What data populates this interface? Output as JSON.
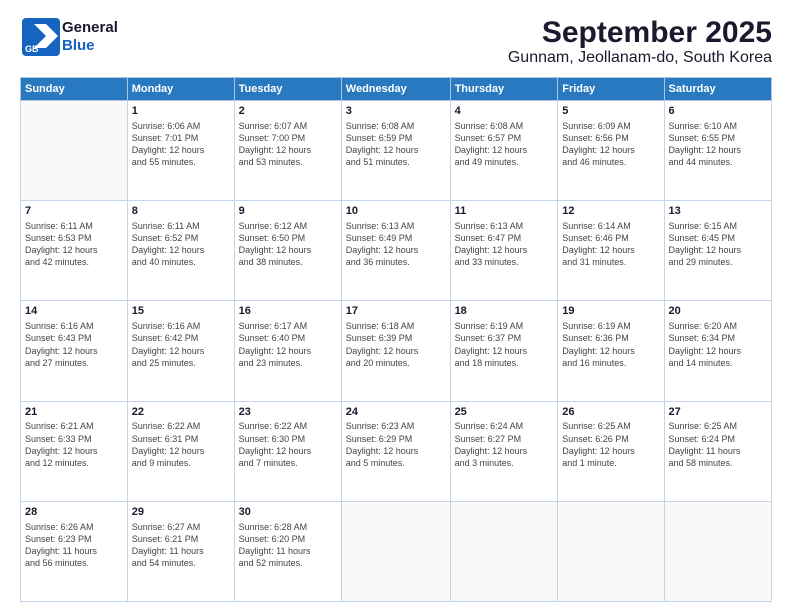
{
  "header": {
    "logo_line1": "General",
    "logo_line2": "Blue",
    "title": "September 2025",
    "subtitle": "Gunnam, Jeollanam-do, South Korea"
  },
  "calendar": {
    "days_of_week": [
      "Sunday",
      "Monday",
      "Tuesday",
      "Wednesday",
      "Thursday",
      "Friday",
      "Saturday"
    ],
    "weeks": [
      [
        {
          "day": "",
          "info": ""
        },
        {
          "day": "1",
          "info": "Sunrise: 6:06 AM\nSunset: 7:01 PM\nDaylight: 12 hours\nand 55 minutes."
        },
        {
          "day": "2",
          "info": "Sunrise: 6:07 AM\nSunset: 7:00 PM\nDaylight: 12 hours\nand 53 minutes."
        },
        {
          "day": "3",
          "info": "Sunrise: 6:08 AM\nSunset: 6:59 PM\nDaylight: 12 hours\nand 51 minutes."
        },
        {
          "day": "4",
          "info": "Sunrise: 6:08 AM\nSunset: 6:57 PM\nDaylight: 12 hours\nand 49 minutes."
        },
        {
          "day": "5",
          "info": "Sunrise: 6:09 AM\nSunset: 6:56 PM\nDaylight: 12 hours\nand 46 minutes."
        },
        {
          "day": "6",
          "info": "Sunrise: 6:10 AM\nSunset: 6:55 PM\nDaylight: 12 hours\nand 44 minutes."
        }
      ],
      [
        {
          "day": "7",
          "info": "Sunrise: 6:11 AM\nSunset: 6:53 PM\nDaylight: 12 hours\nand 42 minutes."
        },
        {
          "day": "8",
          "info": "Sunrise: 6:11 AM\nSunset: 6:52 PM\nDaylight: 12 hours\nand 40 minutes."
        },
        {
          "day": "9",
          "info": "Sunrise: 6:12 AM\nSunset: 6:50 PM\nDaylight: 12 hours\nand 38 minutes."
        },
        {
          "day": "10",
          "info": "Sunrise: 6:13 AM\nSunset: 6:49 PM\nDaylight: 12 hours\nand 36 minutes."
        },
        {
          "day": "11",
          "info": "Sunrise: 6:13 AM\nSunset: 6:47 PM\nDaylight: 12 hours\nand 33 minutes."
        },
        {
          "day": "12",
          "info": "Sunrise: 6:14 AM\nSunset: 6:46 PM\nDaylight: 12 hours\nand 31 minutes."
        },
        {
          "day": "13",
          "info": "Sunrise: 6:15 AM\nSunset: 6:45 PM\nDaylight: 12 hours\nand 29 minutes."
        }
      ],
      [
        {
          "day": "14",
          "info": "Sunrise: 6:16 AM\nSunset: 6:43 PM\nDaylight: 12 hours\nand 27 minutes."
        },
        {
          "day": "15",
          "info": "Sunrise: 6:16 AM\nSunset: 6:42 PM\nDaylight: 12 hours\nand 25 minutes."
        },
        {
          "day": "16",
          "info": "Sunrise: 6:17 AM\nSunset: 6:40 PM\nDaylight: 12 hours\nand 23 minutes."
        },
        {
          "day": "17",
          "info": "Sunrise: 6:18 AM\nSunset: 6:39 PM\nDaylight: 12 hours\nand 20 minutes."
        },
        {
          "day": "18",
          "info": "Sunrise: 6:19 AM\nSunset: 6:37 PM\nDaylight: 12 hours\nand 18 minutes."
        },
        {
          "day": "19",
          "info": "Sunrise: 6:19 AM\nSunset: 6:36 PM\nDaylight: 12 hours\nand 16 minutes."
        },
        {
          "day": "20",
          "info": "Sunrise: 6:20 AM\nSunset: 6:34 PM\nDaylight: 12 hours\nand 14 minutes."
        }
      ],
      [
        {
          "day": "21",
          "info": "Sunrise: 6:21 AM\nSunset: 6:33 PM\nDaylight: 12 hours\nand 12 minutes."
        },
        {
          "day": "22",
          "info": "Sunrise: 6:22 AM\nSunset: 6:31 PM\nDaylight: 12 hours\nand 9 minutes."
        },
        {
          "day": "23",
          "info": "Sunrise: 6:22 AM\nSunset: 6:30 PM\nDaylight: 12 hours\nand 7 minutes."
        },
        {
          "day": "24",
          "info": "Sunrise: 6:23 AM\nSunset: 6:29 PM\nDaylight: 12 hours\nand 5 minutes."
        },
        {
          "day": "25",
          "info": "Sunrise: 6:24 AM\nSunset: 6:27 PM\nDaylight: 12 hours\nand 3 minutes."
        },
        {
          "day": "26",
          "info": "Sunrise: 6:25 AM\nSunset: 6:26 PM\nDaylight: 12 hours\nand 1 minute."
        },
        {
          "day": "27",
          "info": "Sunrise: 6:25 AM\nSunset: 6:24 PM\nDaylight: 11 hours\nand 58 minutes."
        }
      ],
      [
        {
          "day": "28",
          "info": "Sunrise: 6:26 AM\nSunset: 6:23 PM\nDaylight: 11 hours\nand 56 minutes."
        },
        {
          "day": "29",
          "info": "Sunrise: 6:27 AM\nSunset: 6:21 PM\nDaylight: 11 hours\nand 54 minutes."
        },
        {
          "day": "30",
          "info": "Sunrise: 6:28 AM\nSunset: 6:20 PM\nDaylight: 11 hours\nand 52 minutes."
        },
        {
          "day": "",
          "info": ""
        },
        {
          "day": "",
          "info": ""
        },
        {
          "day": "",
          "info": ""
        },
        {
          "day": "",
          "info": ""
        }
      ]
    ]
  }
}
